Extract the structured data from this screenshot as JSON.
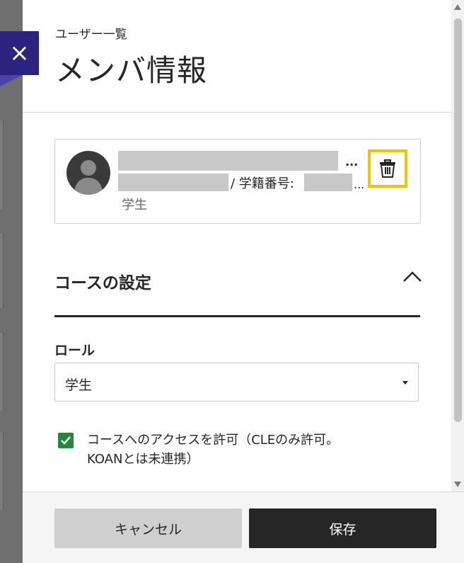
{
  "header": {
    "breadcrumb": "ユーザー一覧",
    "title": "メンバ情報"
  },
  "close_button": {
    "label": "×"
  },
  "user_card": {
    "ellipsis_1": "...",
    "student_id_label": "/ 学籍番号:",
    "ellipsis_2": "...",
    "role": "学生",
    "delete_icon": "trash-icon"
  },
  "course_settings": {
    "title": "コースの設定",
    "toggle_icon": "chevron-up-icon",
    "role_label": "ロール",
    "role_value": "学生",
    "access_checkbox": {
      "checked": true,
      "label_line1": "コースへのアクセスを許可（CLEのみ許可。",
      "label_line2": "KOANとは未連携）"
    }
  },
  "footer": {
    "cancel_label": "キャンセル",
    "save_label": "保存"
  },
  "colors": {
    "close_bg": "#2a2480",
    "highlight": "#f2c200",
    "checkbox": "#1f8a3a",
    "primary_button": "#262626"
  }
}
